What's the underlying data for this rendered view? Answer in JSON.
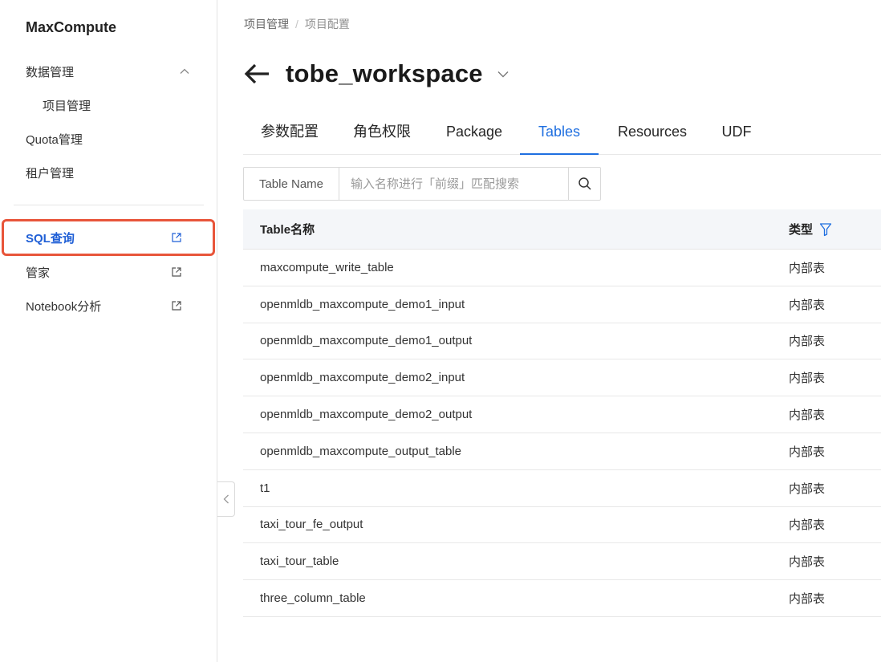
{
  "sidebar": {
    "brand": "MaxCompute",
    "items": [
      {
        "label": "数据管理",
        "icon": "chevron-up-icon"
      },
      {
        "label": "项目管理"
      },
      {
        "label": "Quota管理"
      },
      {
        "label": "租户管理"
      },
      {
        "label": "SQL查询",
        "icon": "external-link-icon",
        "active": true
      },
      {
        "label": "管家",
        "icon": "external-link-icon"
      },
      {
        "label": "Notebook分析",
        "icon": "external-link-icon"
      }
    ]
  },
  "breadcrumb": [
    "项目管理",
    "/",
    "项目配置"
  ],
  "header": {
    "title": "tobe_workspace"
  },
  "tabs": [
    {
      "label": "参数配置"
    },
    {
      "label": "角色权限"
    },
    {
      "label": "Package"
    },
    {
      "label": "Tables",
      "active": true
    },
    {
      "label": "Resources"
    },
    {
      "label": "UDF"
    }
  ],
  "search": {
    "label": "Table Name",
    "value": "",
    "placeholder": "输入名称进行「前缀」匹配搜索"
  },
  "table": {
    "columns": [
      "Table名称",
      "类型"
    ],
    "rows": [
      [
        "maxcompute_write_table",
        "内部表"
      ],
      [
        "openmldb_maxcompute_demo1_input",
        "内部表"
      ],
      [
        "openmldb_maxcompute_demo1_output",
        "内部表"
      ],
      [
        "openmldb_maxcompute_demo2_input",
        "内部表"
      ],
      [
        "openmldb_maxcompute_demo2_output",
        "内部表"
      ],
      [
        "openmldb_maxcompute_output_table",
        "内部表"
      ],
      [
        "t1",
        "内部表"
      ],
      [
        "taxi_tour_fe_output",
        "内部表"
      ],
      [
        "taxi_tour_table",
        "内部表"
      ],
      [
        "three_column_table",
        "内部表"
      ]
    ]
  },
  "colors": {
    "accent": "#1f6fe0",
    "highlight_border": "#e8553a"
  }
}
